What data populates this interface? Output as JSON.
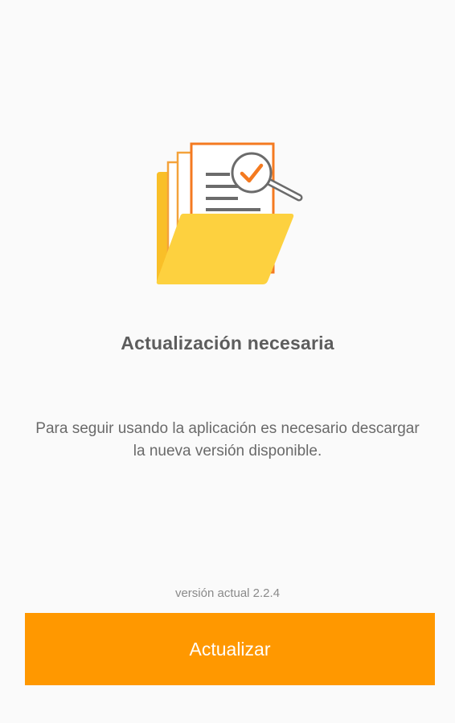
{
  "screen": {
    "title": "Actualización necesaria",
    "message": "Para seguir usando la aplicación es necesario descargar la nueva versión disponible.",
    "version": "versión actual 2.2.4",
    "update_button_label": "Actualizar"
  },
  "illustration": {
    "icon": "folder-document-search-icon",
    "colors": {
      "folder": "#fdd13f",
      "folder_back": "#f9bf28",
      "accent": "#f47a20",
      "lines": "#6b6b6b"
    }
  },
  "colors": {
    "button": "#ff9800",
    "background": "#fafafa",
    "title": "#5d5d5d",
    "text": "#6a6a6a"
  }
}
